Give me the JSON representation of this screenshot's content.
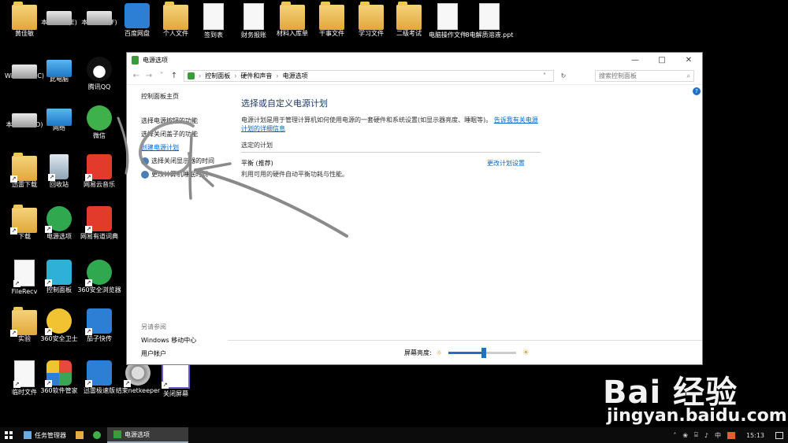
{
  "desktop": {
    "icons": [
      {
        "label": "黄佳敏",
        "kind": "g-folder"
      },
      {
        "label": "本地磁盘 (E)",
        "kind": "g-disk"
      },
      {
        "label": "本地磁盘 (F)",
        "kind": "g-disk"
      },
      {
        "label": "百度网盘",
        "kind": "g-blue"
      },
      {
        "label": "个人文件",
        "kind": "g-folder"
      },
      {
        "label": "签到表",
        "kind": "g-doc"
      },
      {
        "label": "财务报账",
        "kind": "g-doc"
      },
      {
        "label": "材料入库单",
        "kind": "g-folder"
      },
      {
        "label": "干事文件",
        "kind": "g-folder"
      },
      {
        "label": "学习文件",
        "kind": "g-folder"
      },
      {
        "label": "二级考试",
        "kind": "g-folder"
      },
      {
        "label": "电脑操作文件",
        "kind": "g-doc"
      },
      {
        "label": "8电解质溶液.ppt",
        "kind": "g-doc"
      },
      {
        "label": "Windows (C)",
        "kind": "g-disk"
      },
      {
        "label": "此电脑",
        "kind": "g-pc"
      },
      {
        "label": "腾讯QQ",
        "kind": "g-penguin"
      },
      {
        "label": "本地磁盘 (D)",
        "kind": "g-disk"
      },
      {
        "label": "网络",
        "kind": "g-pc"
      },
      {
        "label": "微信",
        "kind": "g-wechat"
      },
      {
        "label": "迅雷下载",
        "kind": "g-folder"
      },
      {
        "label": "回收站",
        "kind": "g-bin"
      },
      {
        "label": "网易云音乐",
        "kind": "g-red"
      },
      {
        "label": "下载",
        "kind": "g-folder"
      },
      {
        "label": "电源选项",
        "kind": "g-green"
      },
      {
        "label": "网易有道词典",
        "kind": "g-red"
      },
      {
        "label": "FileRecv",
        "kind": "g-doc"
      },
      {
        "label": "控制面板",
        "kind": "g-teal"
      },
      {
        "label": "360安全浏览器",
        "kind": "g-green"
      },
      {
        "label": "实验",
        "kind": "g-folder"
      },
      {
        "label": "360安全卫士",
        "kind": "g-yellow"
      },
      {
        "label": "茄子快传",
        "kind": "g-blue"
      },
      {
        "label": "临时文件",
        "kind": "g-doc"
      },
      {
        "label": "360软件管家",
        "kind": "g-multi"
      },
      {
        "label": "迅雷极速版",
        "kind": "g-blue"
      },
      {
        "label": "结束netkeeper",
        "kind": "g-gear"
      },
      {
        "label": "关闭屏幕",
        "kind": "g-clip"
      }
    ]
  },
  "window": {
    "title": "电源选项",
    "controls": {
      "minimize": "—",
      "maximize": "□",
      "close": "✕"
    },
    "breadcrumb": [
      "控制面板",
      "硬件和声音",
      "电源选项"
    ],
    "search_placeholder": "搜索控制面板",
    "left_nav": {
      "home": "控制面板主页",
      "items": [
        "选择电源按钮的功能",
        "选择关闭盖子的功能",
        "创建电源计划",
        "选择关闭显示器的时间",
        "更改计算机睡眠时间"
      ]
    },
    "see_also": {
      "heading": "另请参阅",
      "items": [
        "Windows 移动中心",
        "用户帐户"
      ]
    },
    "main": {
      "heading": "选择或自定义电源计划",
      "description": "电源计划是用于管理计算机如何使用电源的一套硬件和系统设置(如显示器亮度、睡眠等)。",
      "description_link": "告诉我有关电源计划的详细信息",
      "plans_label": "选定的计划",
      "plan_name": "平衡 (推荐)",
      "plan_link": "更改计划设置",
      "plan_desc": "利用可用的硬件自动平衡功耗与性能。"
    },
    "help": "?",
    "brightness": {
      "label": "屏幕亮度:",
      "level_percent": 52
    }
  },
  "taskbar": {
    "tasks": [
      "任务管理器",
      "电源选项"
    ],
    "tray": {
      "ime": "中",
      "time": "15:13"
    }
  },
  "watermark": {
    "line1": "Bai 经验",
    "line2": "jingyan.baidu.com"
  }
}
